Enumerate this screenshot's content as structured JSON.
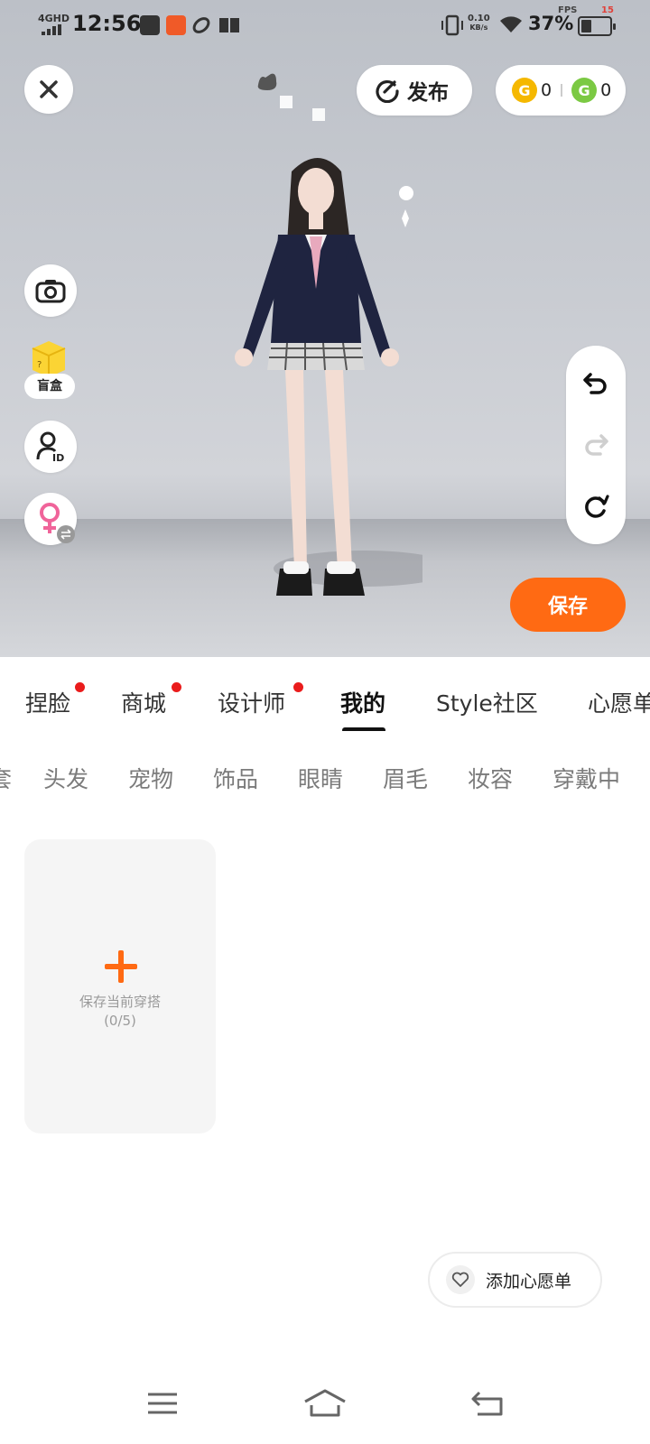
{
  "status_bar": {
    "network": "4GHD",
    "time": "12:56",
    "speed_value": "0.10",
    "speed_unit": "KB/s",
    "battery_percent": "37%",
    "battery_level": 0.37,
    "fps_label": "FPS",
    "fps_value": "15"
  },
  "top_bar": {
    "publish_label": "发布",
    "coin_gold_value": "0",
    "coin_green_value": "0"
  },
  "side_buttons": {
    "blind_box_label": "盲盒"
  },
  "save_label": "保存",
  "main_tabs": [
    {
      "label": "捏脸",
      "has_dot": true
    },
    {
      "label": "商城",
      "has_dot": true
    },
    {
      "label": "设计师",
      "has_dot": true
    },
    {
      "label": "我的",
      "active": true
    },
    {
      "label": "Style社区"
    },
    {
      "label": "心愿单"
    }
  ],
  "sub_tabs": [
    "套",
    "头发",
    "宠物",
    "饰品",
    "眼睛",
    "眉毛",
    "妆容",
    "穿戴中"
  ],
  "outfit_card": {
    "label": "保存当前穿搭",
    "count": "(0/5)"
  },
  "wishlist_label": "添加心愿单",
  "colors": {
    "accent": "#ff6a13",
    "notification_dot": "#ea1c1c",
    "coin_gold": "#f5b800",
    "coin_green": "#7bc943",
    "gender_icon": "#f0649a"
  }
}
